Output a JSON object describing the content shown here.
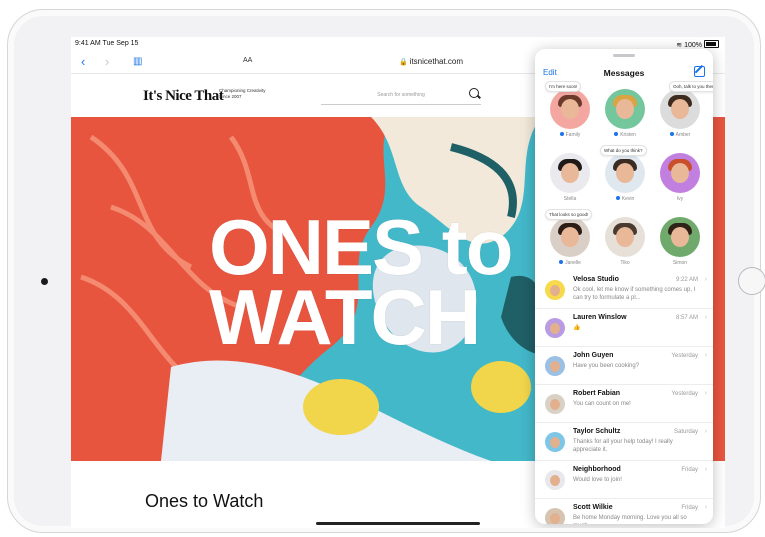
{
  "status": {
    "time": "9:41 AM",
    "date": "Tue Sep 15",
    "battery": "100%"
  },
  "browser": {
    "aa_label": "AA",
    "url": "itsnicethat.com",
    "back_icon": "chevron-left-icon",
    "forward_icon": "chevron-right-icon",
    "bookmarks_icon": "book-icon"
  },
  "site": {
    "logo": "It's Nice That",
    "tagline_line1": "Championing Creativity",
    "tagline_line2": "Since 2007",
    "search_placeholder": "Search for something"
  },
  "hero": {
    "line1": "ONES to",
    "line2": "WATCH"
  },
  "article": {
    "title": "Ones to Watch"
  },
  "messages": {
    "edit_label": "Edit",
    "title": "Messages",
    "pinned": [
      {
        "name": "Family",
        "bubble": "I'm here soon!",
        "unread": true,
        "bg": "#f4a6a0",
        "hair": "#6b3a2a"
      },
      {
        "name": "Kristen",
        "bubble": "",
        "unread": true,
        "bg": "#74c69d",
        "hair": "#d9a441"
      },
      {
        "name": "Amber",
        "bubble": "Ooh, talk to you then!",
        "unread": true,
        "bg": "#dcdcdc",
        "hair": "#3d2b1f"
      },
      {
        "name": "Stella",
        "bubble": "",
        "unread": false,
        "bg": "#e9e9ee",
        "hair": "#1f1a17"
      },
      {
        "name": "Kevin",
        "bubble": "What do you think?",
        "unread": true,
        "bg": "#dfe7ef",
        "hair": "#3a2c22"
      },
      {
        "name": "Ivy",
        "bubble": "",
        "unread": false,
        "bg": "#c17fe0",
        "hair": "#c94f2b"
      },
      {
        "name": "Janelle",
        "bubble": "That looks so good!",
        "unread": true,
        "bg": "#d9cfc7",
        "hair": "#2b1d16"
      },
      {
        "name": "Tiko",
        "bubble": "",
        "unread": false,
        "bg": "#e7e0d8",
        "hair": "#4a3a30"
      },
      {
        "name": "Simon",
        "bubble": "",
        "unread": false,
        "bg": "#6fa96c",
        "hair": "#2e2218"
      }
    ],
    "conversations": [
      {
        "name": "Velosa Studio",
        "time": "9:22 AM",
        "preview": "Ok cool, let me know if something comes up, I can try to formulate a pl...",
        "bg": "#f7d94c"
      },
      {
        "name": "Lauren Winslow",
        "time": "8:57 AM",
        "preview": "👍",
        "bg": "#b99be3"
      },
      {
        "name": "John Guyen",
        "time": "Yesterday",
        "preview": "Have you been cooking?",
        "bg": "#9cc0e4"
      },
      {
        "name": "Robert Fabian",
        "time": "Yesterday",
        "preview": "You can count on me!",
        "bg": "#d8d1c6"
      },
      {
        "name": "Taylor Schultz",
        "time": "Saturday",
        "preview": "Thanks for all your help today! I really appreciate it.",
        "bg": "#7ec6e8"
      },
      {
        "name": "Neighborhood",
        "time": "Friday",
        "preview": "Would love to join!",
        "bg": "#e7e7ec"
      },
      {
        "name": "Scott Wilkie",
        "time": "Friday",
        "preview": "Be home Monday morning. Love you all so much.",
        "bg": "#d6c4b0"
      }
    ]
  }
}
